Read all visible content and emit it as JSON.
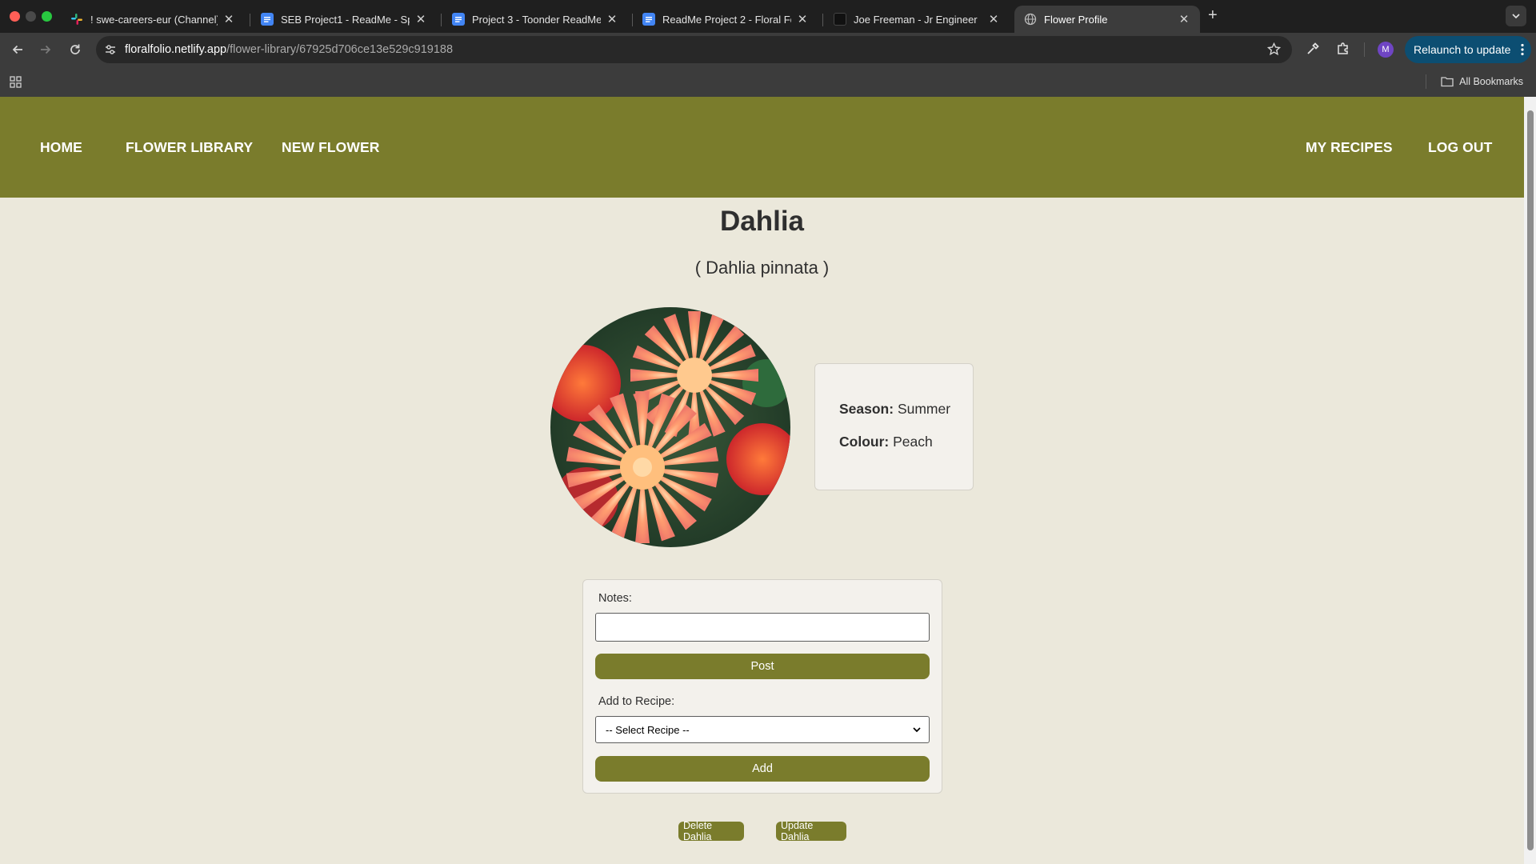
{
  "browser": {
    "tabs": [
      {
        "title": "! swe-careers-eur (Channel)",
        "icon": "slack-icon",
        "active": false
      },
      {
        "title": "SEB Project1 - ReadMe - Spa",
        "icon": "docs-icon",
        "active": false
      },
      {
        "title": "Project 3 - Toonder ReadMe",
        "icon": "docs-icon",
        "active": false
      },
      {
        "title": "ReadMe Project 2 - Floral Fol",
        "icon": "docs-icon",
        "active": false
      },
      {
        "title": "Joe Freeman - Jr Engineer",
        "icon": "site-icon",
        "active": false
      },
      {
        "title": "Flower Profile",
        "icon": "globe-icon",
        "active": true
      }
    ],
    "url_host": "floralfolio.netlify.app",
    "url_path": "/flower-library/67925d706ce13e529c919188",
    "profile_initial": "M",
    "relaunch_label": "Relaunch to update",
    "bookmarks_label": "All Bookmarks",
    "colors": {
      "tabstrip": "#1f1f1f",
      "toolbar": "#3c3c3c",
      "relaunch": "#0c4e72",
      "avatar": "#6f45c4"
    }
  },
  "site": {
    "nav": {
      "home": "HOME",
      "library": "FLOWER LIBRARY",
      "new_flower": "NEW FLOWER",
      "my_recipes": "MY RECIPES",
      "logout": "LOG OUT"
    },
    "colors": {
      "nav_bg": "#7a7c2c",
      "page_bg": "#ebe8db",
      "button": "#7a7c2c"
    }
  },
  "flower": {
    "name": "Dahlia",
    "scientific": "( Dahlia pinnata )",
    "season_label": "Season:",
    "season": "Summer",
    "colour_label": "Colour:",
    "colour": "Peach"
  },
  "form": {
    "notes_label": "Notes:",
    "notes_value": "",
    "post_label": "Post",
    "recipe_label": "Add to Recipe:",
    "recipe_selected": "-- Select Recipe --",
    "add_label": "Add"
  },
  "actions": {
    "delete_label": "Delete Dahlia",
    "update_label": "Update Dahlia"
  }
}
